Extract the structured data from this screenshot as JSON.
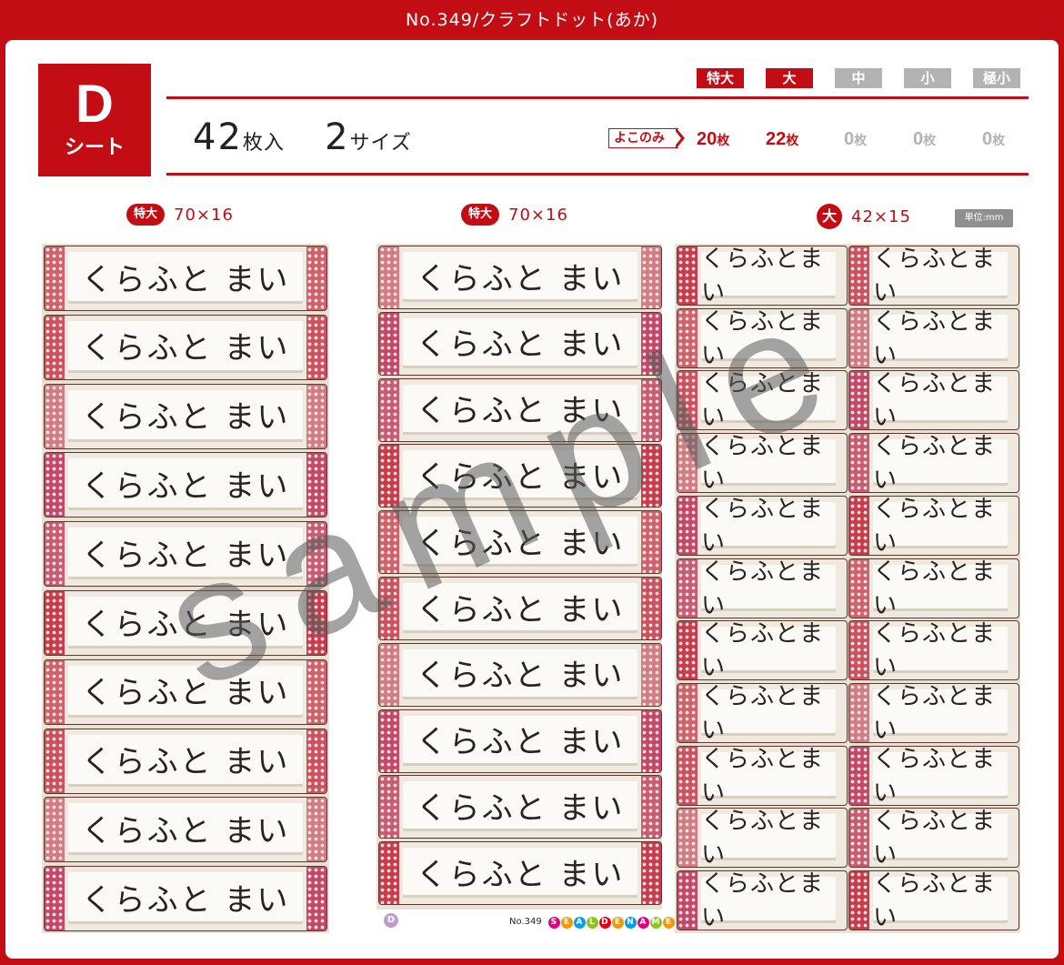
{
  "header": {
    "title": "No.349/クラフトドット(あか)"
  },
  "sheet": {
    "letter": "D",
    "kind": "シート"
  },
  "count": {
    "number": "42",
    "number_unit": "枚入",
    "sizes": "2",
    "sizes_unit": "サイズ"
  },
  "size_tabs": [
    {
      "label": "特大",
      "active": true
    },
    {
      "label": "大",
      "active": true
    },
    {
      "label": "中",
      "active": false
    },
    {
      "label": "小",
      "active": false
    },
    {
      "label": "極小",
      "active": false
    }
  ],
  "orientation": {
    "label": "よこのみ"
  },
  "size_counts": [
    {
      "value": "20",
      "unit": "枚",
      "active": true
    },
    {
      "value": "22",
      "unit": "枚",
      "active": true
    },
    {
      "value": "0",
      "unit": "枚",
      "active": false
    },
    {
      "value": "0",
      "unit": "枚",
      "active": false
    },
    {
      "value": "0",
      "unit": "枚",
      "active": false
    }
  ],
  "columns": [
    {
      "badge": "特大",
      "dims": "70×16"
    },
    {
      "badge": "特大",
      "dims": "70×16"
    },
    {
      "badge": "大",
      "dims": "42×15"
    }
  ],
  "unit_note": "単位:mm",
  "label_text": "くらふと まい",
  "label_text_small": "くらふとまい",
  "footer": {
    "badge": "D",
    "no": "No.349",
    "brand": "SEALDENAME"
  },
  "watermark": "sample",
  "colors": {
    "accent": "#c30d14",
    "inactive": "#b3b3b3"
  }
}
